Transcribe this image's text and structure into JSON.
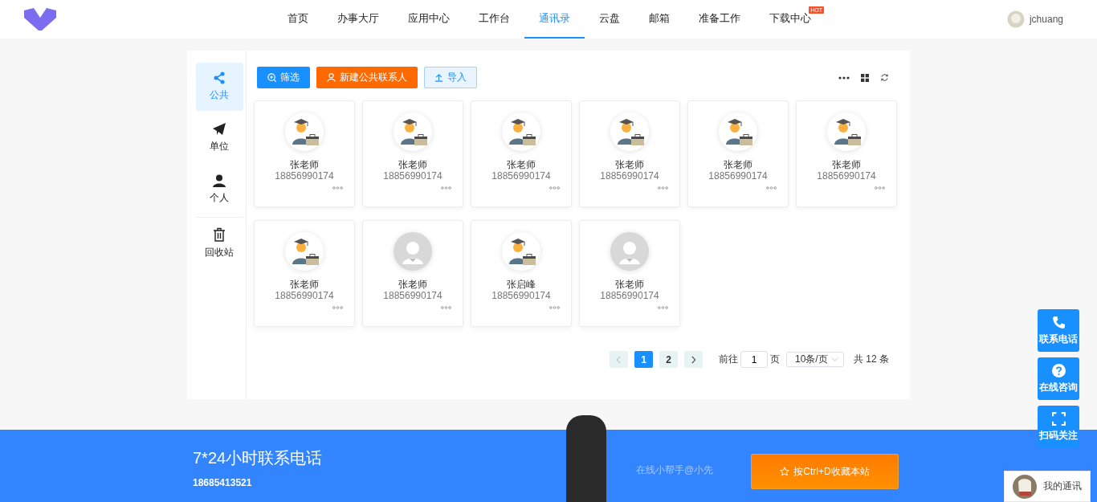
{
  "header": {
    "nav": [
      {
        "label": "首页",
        "selected": false
      },
      {
        "label": "办事大厅",
        "selected": false
      },
      {
        "label": "应用中心",
        "selected": false
      },
      {
        "label": "工作台",
        "selected": false
      },
      {
        "label": "通讯录",
        "selected": true
      },
      {
        "label": "云盘",
        "selected": false
      },
      {
        "label": "邮箱",
        "selected": false
      },
      {
        "label": "准备工作",
        "selected": false
      },
      {
        "label": "下载中心",
        "selected": false,
        "badge": "HOT"
      }
    ],
    "user": "jchuang"
  },
  "sidebar": {
    "items": [
      {
        "label": "公共",
        "selected": true
      },
      {
        "label": "单位",
        "selected": false
      },
      {
        "label": "个人",
        "selected": false
      },
      {
        "label": "回收站",
        "selected": false
      }
    ]
  },
  "toolbar": {
    "buttons": [
      {
        "kind": "primary",
        "label": "筛选"
      },
      {
        "kind": "warning",
        "label": "新建公共联系人"
      },
      {
        "kind": "plain",
        "label": "导入"
      }
    ]
  },
  "contacts": [
    {
      "kind": "teacher",
      "name": "张老师",
      "phone": "18856990174"
    },
    {
      "kind": "teacher",
      "name": "张老师",
      "phone": "18856990174"
    },
    {
      "kind": "teacher",
      "name": "张老师",
      "phone": "18856990174"
    },
    {
      "kind": "teacher",
      "name": "张老师",
      "phone": "18856990174"
    },
    {
      "kind": "teacher",
      "name": "张老师",
      "phone": "18856990174"
    },
    {
      "kind": "teacher",
      "name": "张老师",
      "phone": "18856990174"
    },
    {
      "kind": "teacher",
      "name": "张老师",
      "phone": "18856990174"
    },
    {
      "kind": "default",
      "name": "张老师",
      "phone": "18856990174"
    },
    {
      "kind": "teacher",
      "name": "张启峰",
      "phone": "18856990174"
    },
    {
      "kind": "default",
      "name": "张老师",
      "phone": "18856990174"
    }
  ],
  "pagination": {
    "prev_disabled": true,
    "pages": [
      {
        "label": "1",
        "selected": true
      },
      {
        "label": "2",
        "selected": false
      }
    ],
    "goto_label": "前往",
    "goto_value": "1",
    "page_unit": "页",
    "page_size": "10条/页",
    "total": "共 12 条"
  },
  "side_buttons": [
    {
      "label": "联系电话"
    },
    {
      "label": "在线咨询"
    },
    {
      "label": "扫码关注"
    }
  ],
  "footer": {
    "title": "7*24小时联系电话",
    "phone": "18685413521",
    "helper": "在线小帮手@小先",
    "bookmark_button": "按Ctrl+D收藏本站"
  },
  "chat_widget": {
    "label": "我的通讯"
  }
}
